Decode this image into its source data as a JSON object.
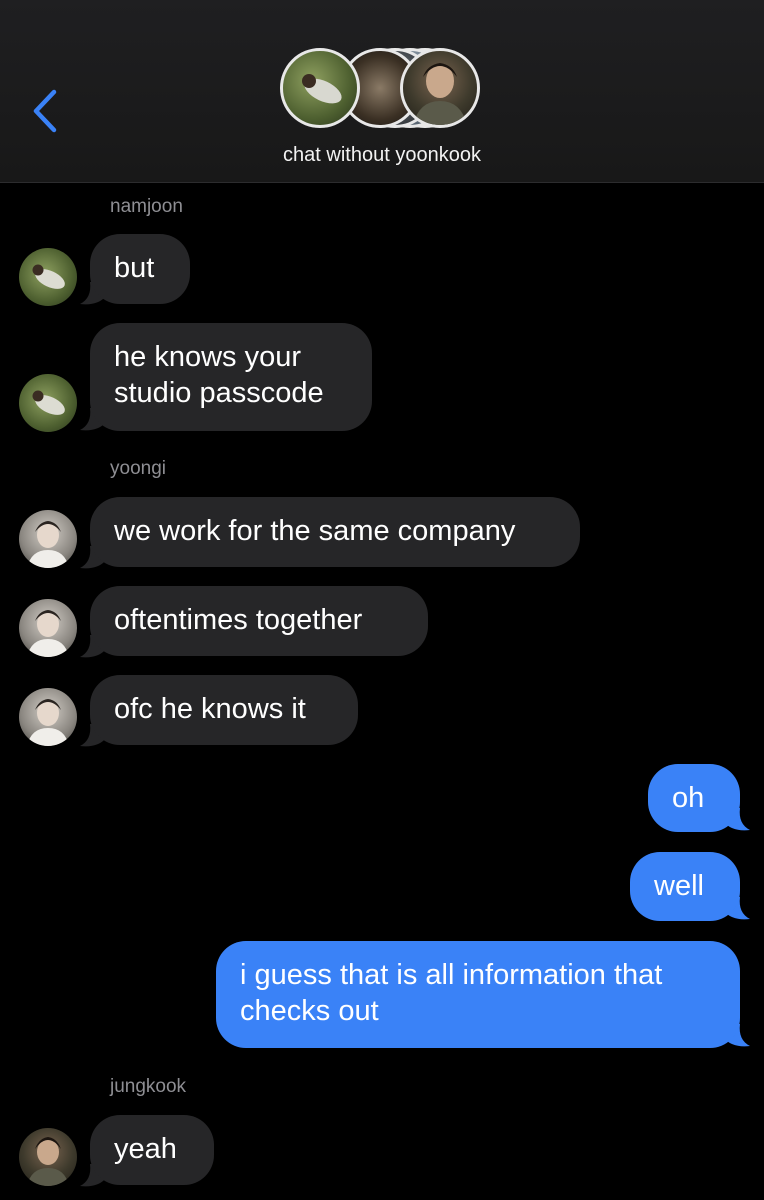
{
  "header": {
    "title": "chat without yoonkook",
    "back_icon": "chevron-left-icon",
    "accent_color": "#3a82f7"
  },
  "messages": [
    {
      "sender": "namjoon",
      "text": "but"
    },
    {
      "text_lines": [
        "he knows your",
        "studio passcode"
      ]
    },
    {
      "sender": "yoongi",
      "text": "we work for the same company"
    },
    {
      "text": "oftentimes together"
    },
    {
      "text": "ofc he knows it"
    },
    {
      "text": "oh"
    },
    {
      "text": "well"
    },
    {
      "text_lines": [
        "i guess that is all information that",
        "checks out"
      ]
    },
    {
      "sender": "jungkook",
      "text": "yeah"
    }
  ],
  "colors": {
    "background": "#000000",
    "incoming_bubble": "#262628",
    "outgoing_bubble": "#3a82f7",
    "sender_label": "#8e8e93"
  }
}
